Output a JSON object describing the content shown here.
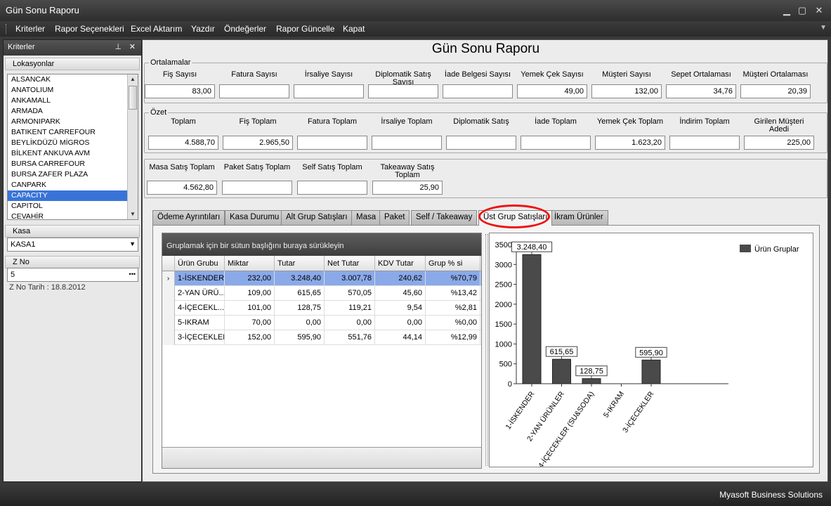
{
  "window": {
    "title": "Gün Sonu Raporu"
  },
  "menu": [
    "Kriterler",
    "Rapor Seçenekleri",
    "Excel Aktarım",
    "Yazdır",
    "Öndeğerler",
    "Rapor Güncelle",
    "Kapat"
  ],
  "left_panel": {
    "title": "Kriterler",
    "lokasyon_caption": "Lokasyonlar",
    "locations": [
      "ALSANCAK",
      "ANATOLIUM",
      "ANKAMALL",
      "ARMADA",
      "ARMONIPARK",
      "BATIKENT CARREFOUR",
      "BEYLİKDÜZÜ MİGROS",
      "BİLKENT ANKUVA AVM",
      "BURSA CARREFOUR",
      "BURSA ZAFER PLAZA",
      "CANPARK",
      "CAPACITY",
      "CAPITOL",
      "CEVAHİR"
    ],
    "selected_location": "CAPACITY",
    "kasa_caption": "Kasa",
    "kasa_value": "KASA1",
    "zno_caption": "Z No",
    "zno_value": "5",
    "zno_date": "Z No Tarih : 18.8.2012"
  },
  "report": {
    "title": "Gün Sonu Raporu",
    "ortalamalar": {
      "legend": "Ortalamalar",
      "fields": [
        {
          "label": "Fiş Sayısı",
          "value": "83,00"
        },
        {
          "label": "Fatura Sayısı",
          "value": ""
        },
        {
          "label": "İrsaliye Sayısı",
          "value": ""
        },
        {
          "label": "Diplomatik Satış Sayısı",
          "value": ""
        },
        {
          "label": "İade Belgesi Sayısı",
          "value": ""
        },
        {
          "label": "Yemek Çek Sayısı",
          "value": "49,00"
        },
        {
          "label": "Müşteri Sayısı",
          "value": "132,00"
        },
        {
          "label": "Sepet Ortalaması",
          "value": "34,76"
        },
        {
          "label": "Müşteri Ortalaması",
          "value": "20,39"
        }
      ]
    },
    "ozet": {
      "legend": "Özet",
      "fields": [
        {
          "label": "Toplam",
          "value": "4.588,70"
        },
        {
          "label": "Fiş Toplam",
          "value": "2.965,50"
        },
        {
          "label": "Fatura Toplam",
          "value": ""
        },
        {
          "label": "İrsaliye Toplam",
          "value": ""
        },
        {
          "label": "Diplomatik Satış",
          "value": ""
        },
        {
          "label": "İade Toplam",
          "value": ""
        },
        {
          "label": "Yemek Çek Toplam",
          "value": "1.623,20"
        },
        {
          "label": "İndirim Toplam",
          "value": ""
        },
        {
          "label": "Girilen Müşteri Adedi",
          "value": "225,00"
        }
      ]
    },
    "satis": {
      "fields": [
        {
          "label": "Masa Satış Toplam",
          "value": "4.562,80"
        },
        {
          "label": "Paket Satış Toplam",
          "value": ""
        },
        {
          "label": "Self Satış Toplam",
          "value": ""
        },
        {
          "label": "Takeaway Satış Toplam",
          "value": "25,90"
        }
      ]
    }
  },
  "tabs": [
    "Ödeme Ayrıntıları",
    "Kasa Durumu",
    "Alt Grup Satışları",
    "Masa",
    "Paket",
    "Self / Takeaway",
    "Üst Grup Satışları",
    "İkram Ürünler"
  ],
  "active_tab": "Üst Grup Satışları",
  "grid": {
    "group_panel": "Gruplamak için bir sütun başlığını buraya sürükleyin",
    "columns": [
      "Ürün Grubu",
      "Miktar",
      "Tutar",
      "Net Tutar",
      "KDV Tutar",
      "Grup % si"
    ],
    "rows": [
      [
        "1-İSKENDER",
        "232,00",
        "3.248,40",
        "3.007,78",
        "240,62",
        "%70,79"
      ],
      [
        "2-YAN ÜRÜ...",
        "109,00",
        "615,65",
        "570,05",
        "45,60",
        "%13,42"
      ],
      [
        "4-İÇECEKL...",
        "101,00",
        "128,75",
        "119,21",
        "9,54",
        "%2,81"
      ],
      [
        "5-IKRAM",
        "70,00",
        "0,00",
        "0,00",
        "0,00",
        "%0,00"
      ],
      [
        "3-İÇECEKLER",
        "152,00",
        "595,90",
        "551,76",
        "44,14",
        "%12,99"
      ]
    ],
    "row_indicator": "›"
  },
  "chart_data": {
    "type": "bar",
    "categories": [
      "1-İSKENDER",
      "2-YAN ÜRÜNLER",
      "4-İÇECEKLER (SU&SODA)",
      "5-IKRAM",
      "3-İÇECEKLER"
    ],
    "series": [
      {
        "name": "Ürün Gruplar",
        "values": [
          3248.4,
          615.65,
          128.75,
          0,
          595.9
        ]
      }
    ],
    "data_labels": [
      "3.248,40",
      "615,65",
      "128,75",
      "",
      "595,90"
    ],
    "yticks": [
      "3500",
      "3000",
      "2500",
      "2000",
      "1500",
      "1000",
      "500",
      "0"
    ],
    "ylim": [
      0,
      3500
    ],
    "legend_position": "top-right",
    "bar_color": "#4a4a4a"
  },
  "status": "Myasoft Business Solutions"
}
